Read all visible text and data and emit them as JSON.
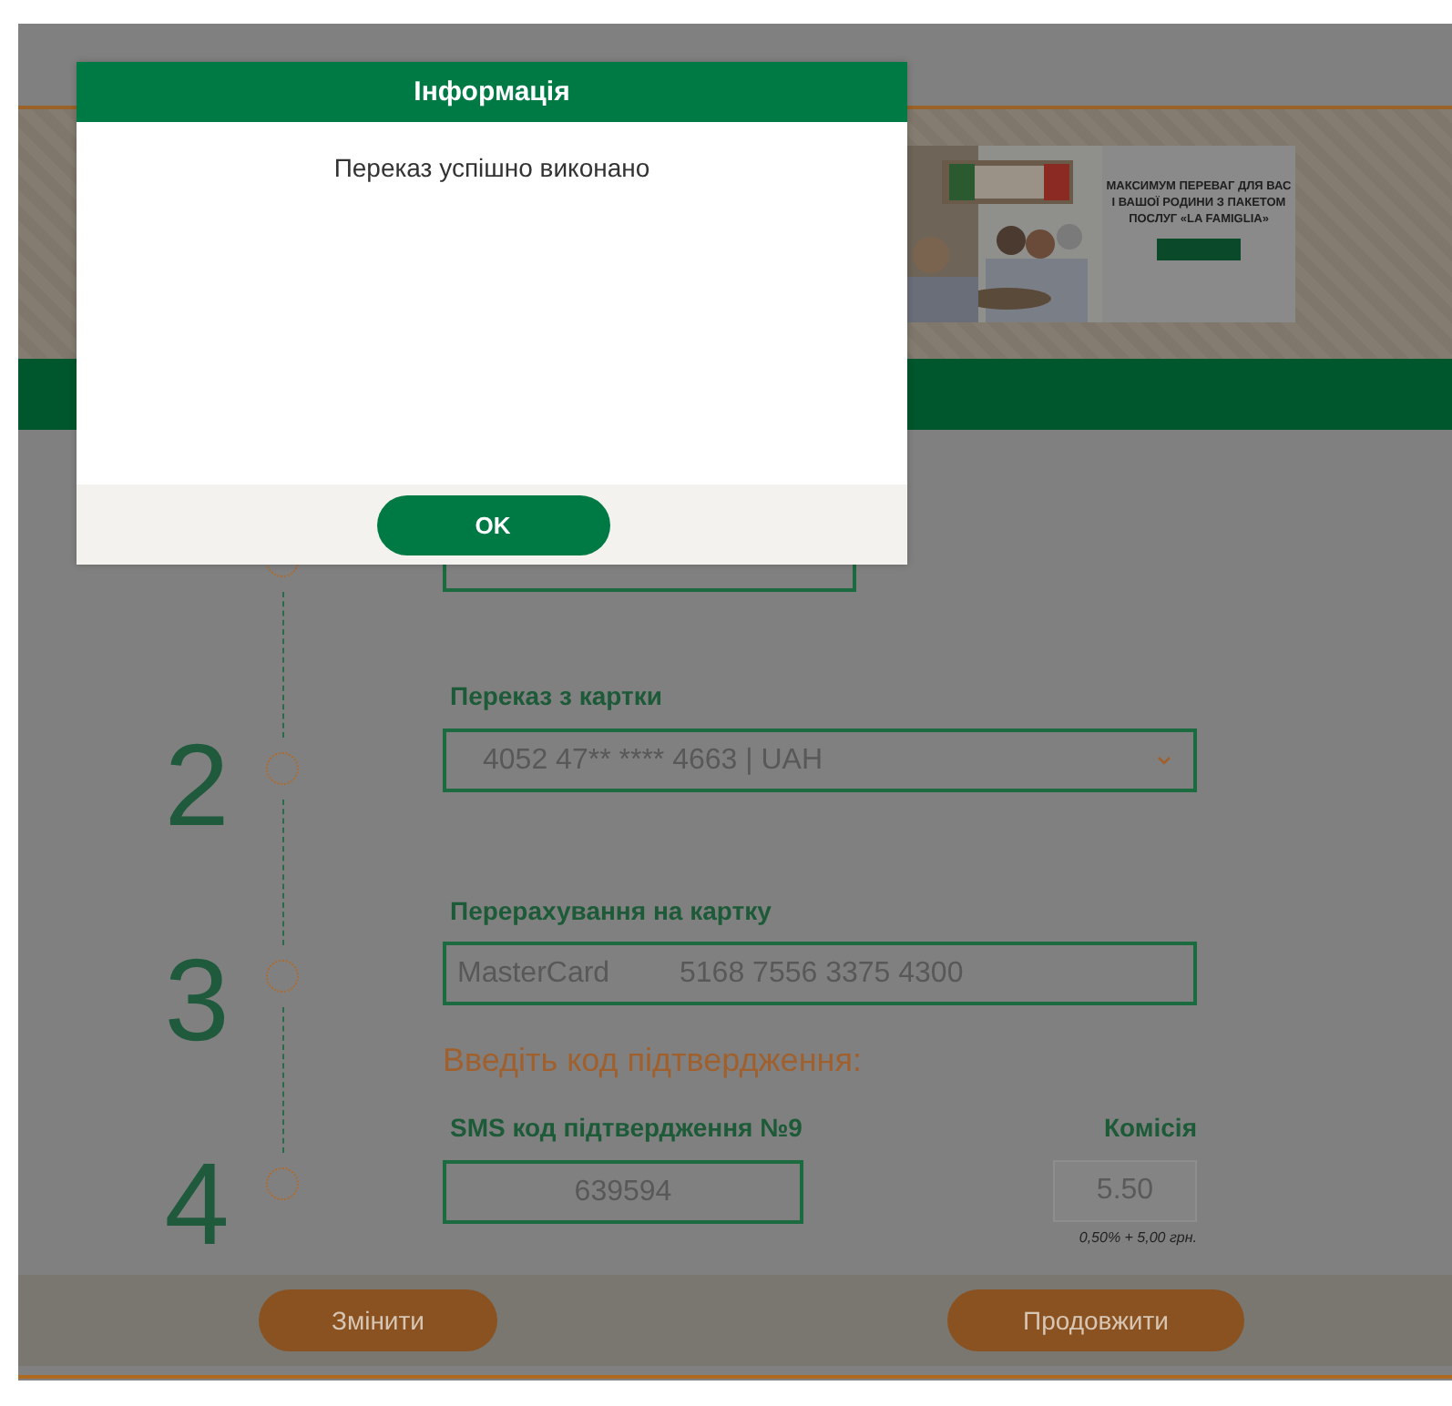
{
  "modal": {
    "title": "Інформація",
    "message": "Переказ успішно виконано",
    "button": "OK"
  },
  "ad": {
    "text_lines": [
      "МАКСИМУМ ПЕРЕВАГ ДЛЯ ВАС",
      "І ВАШОЇ РОДИНИ З ПАКЕТОМ",
      "ПОСЛУГ «LA FAMIGLIA»"
    ]
  },
  "steps": [
    {
      "number": "2"
    },
    {
      "number": "3"
    },
    {
      "number": "4"
    }
  ],
  "from_card": {
    "label": "Переказ з картки",
    "value": "4052 47** **** 4663 | UAH"
  },
  "to_card": {
    "label": "Перерахування на картку",
    "card_type": "MasterCard",
    "value": "5168 7556 3375 4300"
  },
  "confirm_heading": "Введіть код підтвердження:",
  "sms": {
    "label": "SMS код підтвердження №9",
    "value": "639594"
  },
  "commission": {
    "label": "Комісія",
    "value": "5.50",
    "note": "0,50% + 5,00 грн."
  },
  "buttons": [
    {
      "label": "Змінити"
    },
    {
      "label": "Продовжити"
    }
  ]
}
